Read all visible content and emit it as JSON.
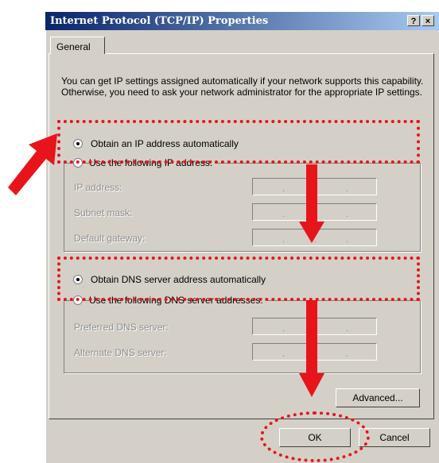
{
  "window": {
    "title": "Internet Protocol (TCP/IP) Properties",
    "help_label": "?",
    "close_label": "×"
  },
  "tabs": [
    {
      "label": "General"
    }
  ],
  "intro_text": "You can get IP settings assigned automatically if your network supports this capability. Otherwise, you need to ask your network administrator for the appropriate IP settings.",
  "ip_section": {
    "obtain_auto_label": "Obtain an IP address automatically",
    "use_following_label": "Use the following IP address:",
    "fields": [
      {
        "label": "IP address:",
        "value": ". . ."
      },
      {
        "label": "Subnet mask:",
        "value": ". . ."
      },
      {
        "label": "Default gateway:",
        "value": ". . ."
      }
    ]
  },
  "dns_section": {
    "obtain_auto_label": "Obtain DNS server address automatically",
    "use_following_label": "Use the following DNS server addresses:",
    "fields": [
      {
        "label": "Preferred DNS server:",
        "value": ". . ."
      },
      {
        "label": "Alternate DNS server:",
        "value": ". . ."
      }
    ]
  },
  "buttons": {
    "advanced": "Advanced...",
    "ok": "OK",
    "cancel": "Cancel"
  },
  "colors": {
    "highlight": "#e8141b",
    "titlebar": "#0a246a",
    "face": "#d4d0c8"
  }
}
